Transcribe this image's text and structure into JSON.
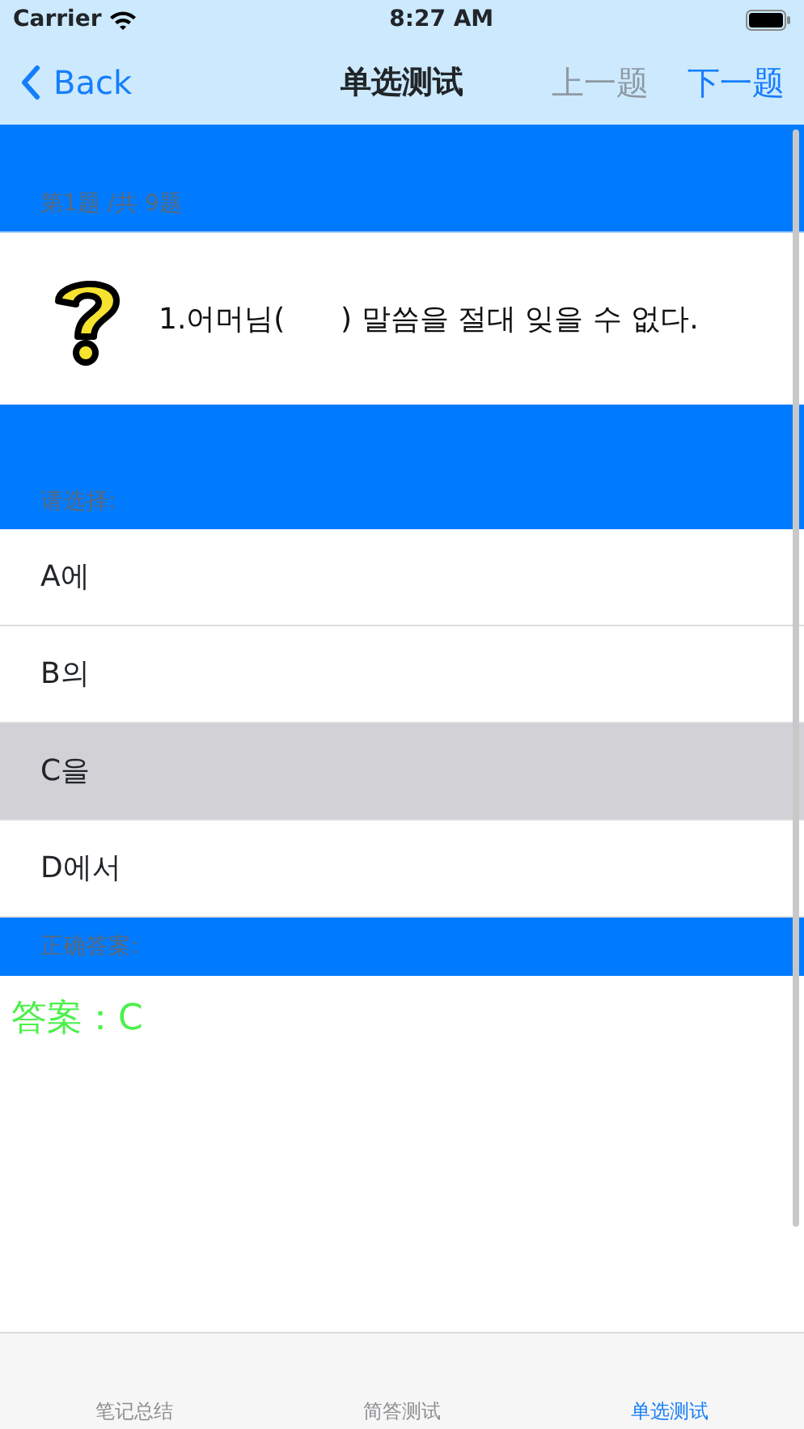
{
  "status_bar": {
    "carrier": "Carrier",
    "time": "8:27 AM"
  },
  "nav": {
    "back": "Back",
    "title": "单选测试",
    "buttons": [
      {
        "label": "上一题",
        "disabled": true
      },
      {
        "label": "下一题",
        "disabled": false
      }
    ]
  },
  "progress": "第1题 /共 9题",
  "question": "1.어머님(      ) 말씀을 절대 잊을 수 없다.",
  "choose_label": "请选择:",
  "options": [
    {
      "label": "A에",
      "selected": false
    },
    {
      "label": "B의",
      "selected": false
    },
    {
      "label": "C을",
      "selected": true
    },
    {
      "label": "D에서",
      "selected": false
    }
  ],
  "answer_label": "正确答案:",
  "answer": "答案：C",
  "tabs": [
    {
      "label": "笔记总结",
      "selected": false
    },
    {
      "label": "简答测试",
      "selected": false
    },
    {
      "label": "单选测试",
      "selected": true
    }
  ]
}
